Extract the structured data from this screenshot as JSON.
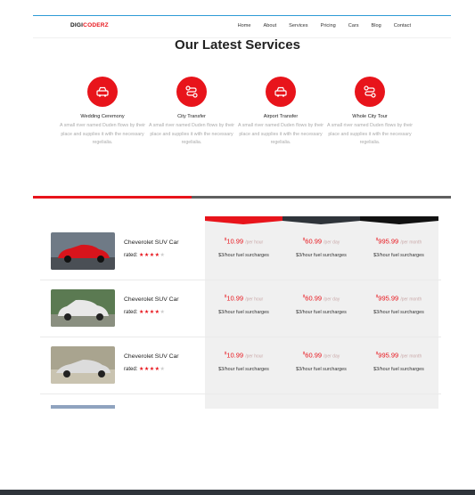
{
  "logo": {
    "part1": "DIGI",
    "part2": "CODERZ"
  },
  "nav": [
    "Home",
    "About",
    "Services",
    "Pricing",
    "Cars",
    "Blog",
    "Contact"
  ],
  "section_title": "Our Latest Services",
  "services": [
    {
      "name": "Wedding Ceremony",
      "desc": "A small river named Duden flows by their place and supplies it with the necessary regelialia.",
      "icon": "car-icon"
    },
    {
      "name": "City Transfer",
      "desc": "A small river named Duden flows by their place and supplies it with the necessary regelialia.",
      "icon": "route-icon"
    },
    {
      "name": "Airport Transfer",
      "desc": "A small river named Duden flows by their place and supplies it with the necessary regelialia.",
      "icon": "car-icon"
    },
    {
      "name": "Whole City Tour",
      "desc": "A small river named Duden flows by their place and supplies it with the necessary regelialia.",
      "icon": "route-icon"
    }
  ],
  "colors": {
    "accent": "#e8141b",
    "dark": "#2f343a",
    "black": "#111111"
  },
  "cars": [
    {
      "name": "Cheverolet SUV Car",
      "rated": "rated:",
      "stars": "★★★★",
      "empty": "★",
      "prices": [
        {
          "currency": "$",
          "amount": "10.99",
          "period": "/per hour",
          "surcharge": "$3/hour fuel surcharges"
        },
        {
          "currency": "$",
          "amount": "60.99",
          "period": "/per day",
          "surcharge": "$3/hour fuel surcharges"
        },
        {
          "currency": "$",
          "amount": "995.99",
          "period": "/per month",
          "surcharge": "$3/hour fuel surcharges"
        }
      ]
    },
    {
      "name": "Cheverolet SUV Car",
      "rated": "rated:",
      "stars": "★★★★",
      "empty": "★",
      "prices": [
        {
          "currency": "$",
          "amount": "10.99",
          "period": "/per hour",
          "surcharge": "$3/hour fuel surcharges"
        },
        {
          "currency": "$",
          "amount": "60.99",
          "period": "/per day",
          "surcharge": "$3/hour fuel surcharges"
        },
        {
          "currency": "$",
          "amount": "995.99",
          "period": "/per month",
          "surcharge": "$3/hour fuel surcharges"
        }
      ]
    },
    {
      "name": "Cheverolet SUV Car",
      "rated": "rated:",
      "stars": "★★★★",
      "empty": "★",
      "prices": [
        {
          "currency": "$",
          "amount": "10.99",
          "period": "/per hour",
          "surcharge": "$3/hour fuel surcharges"
        },
        {
          "currency": "$",
          "amount": "60.99",
          "period": "/per day",
          "surcharge": "$3/hour fuel surcharges"
        },
        {
          "currency": "$",
          "amount": "995.99",
          "period": "/per month",
          "surcharge": "$3/hour fuel surcharges"
        }
      ]
    }
  ]
}
